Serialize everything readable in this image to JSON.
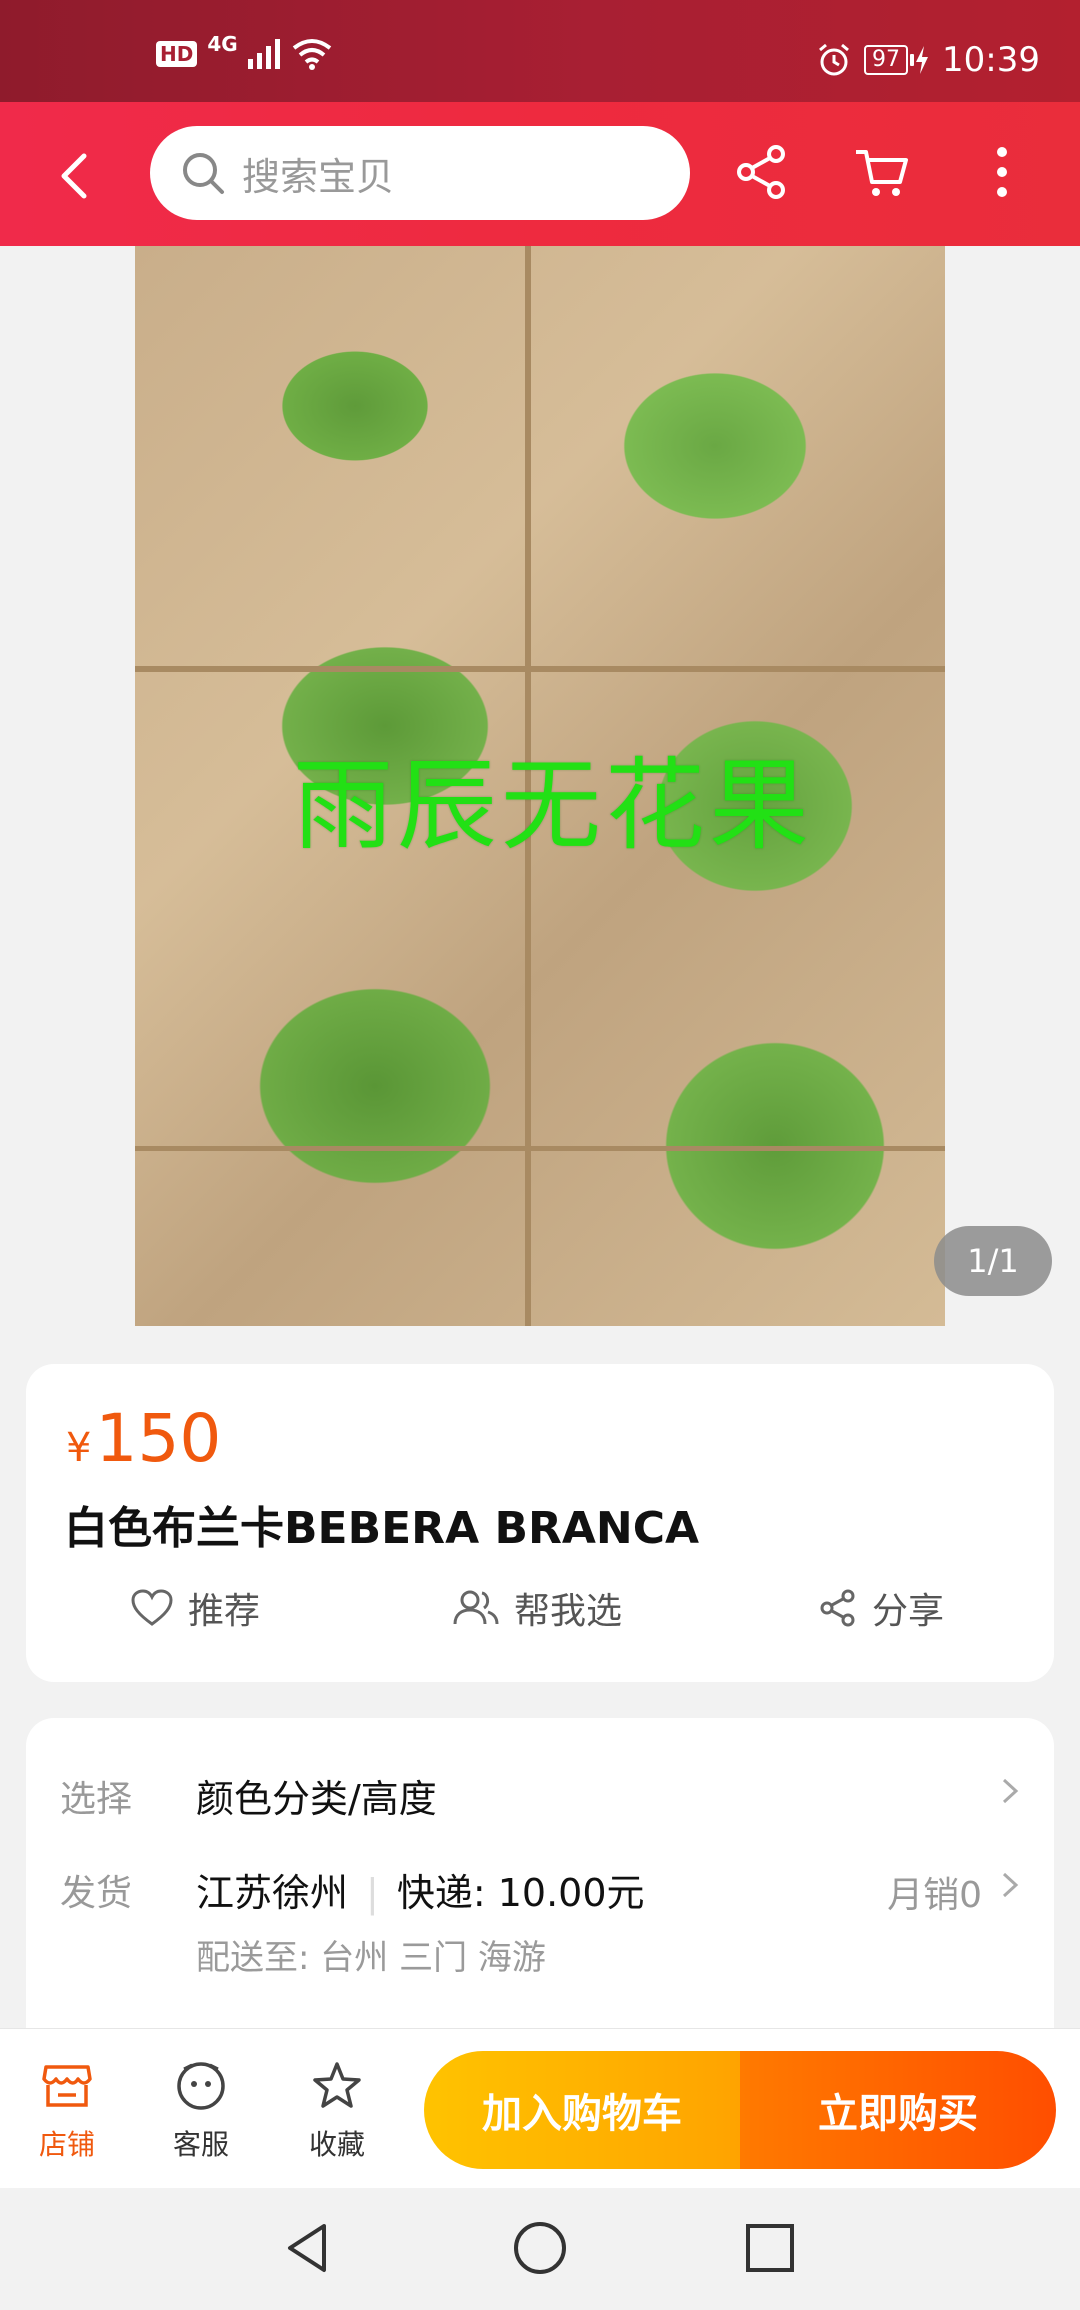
{
  "status_bar": {
    "hd_label": "HD",
    "network_label": "4G",
    "battery": "97",
    "time": "10:39"
  },
  "nav": {
    "search_placeholder": "搜索宝贝"
  },
  "gallery": {
    "watermark_text": "雨辰无花果",
    "counter": "1/1"
  },
  "product": {
    "currency": "¥",
    "price": "150",
    "title": "白色布兰卡BEBERA BRANCA",
    "actions": [
      {
        "label": "推荐",
        "icon": "heart-icon"
      },
      {
        "label": "帮我选",
        "icon": "people-icon"
      },
      {
        "label": "分享",
        "icon": "share-icon"
      }
    ]
  },
  "options": {
    "select_label": "选择",
    "select_value": "颜色分类/高度",
    "ship_label": "发货",
    "ship_origin": "江苏徐州",
    "ship_fee": "快递: 10.00元",
    "monthly_sales": "月销0",
    "deliver_to": "配送至: 台州 三门 海游"
  },
  "bottom_bar": {
    "shop_label": "店铺",
    "service_label": "客服",
    "favorite_label": "收藏",
    "add_to_cart": "加入购物车",
    "buy_now": "立即购买"
  },
  "colors": {
    "nav_red": "#ee2a3f",
    "price_orange": "#f0590e",
    "cart_yellow": "#ffb300",
    "buy_orange": "#ff5a00"
  }
}
